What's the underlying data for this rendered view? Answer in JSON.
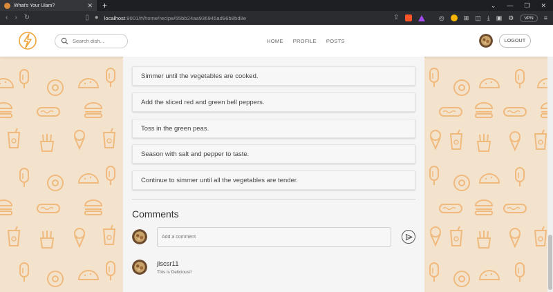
{
  "browser": {
    "tab_title": "What's Your Ulam?",
    "tab_close": "✕",
    "new_tab": "+",
    "url_host": "localhost",
    "url_path": ":9001/#/home/recipe/65bb24aa936945ad96b8bd8e",
    "vpn_label": "VPN"
  },
  "header": {
    "search_placeholder": "Search dish...",
    "nav": [
      "HOME",
      "PROFILE",
      "POSTS"
    ],
    "logout_label": "LOGOUT"
  },
  "steps": [
    "Simmer until the vegetables are cooked.",
    "Add the sliced red and green bell peppers.",
    "Toss in the green peas.",
    "Season with salt and pepper to taste.",
    "Continue to simmer until all the vegetables are tender."
  ],
  "comments": {
    "title": "Comments",
    "input_placeholder": "Add a comment",
    "items": [
      {
        "user": "jlscsr11",
        "text": "This is Delicious!!"
      }
    ]
  },
  "colors": {
    "background": "#f4e3cc",
    "pattern": "#f0b97e",
    "accent": "#f0a43a"
  }
}
